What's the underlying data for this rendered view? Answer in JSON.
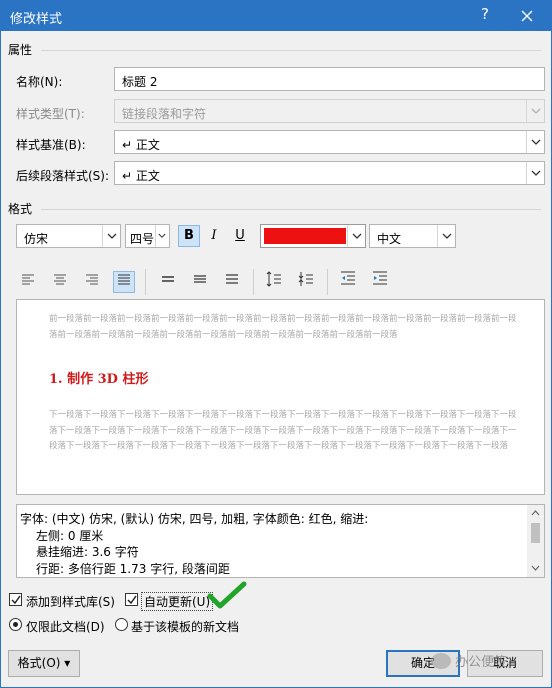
{
  "window": {
    "title": "修改样式",
    "help_glyph": "?"
  },
  "properties": {
    "section_label": "属性",
    "name_label": "名称(N):",
    "name_value": "标题 2",
    "style_type_label": "样式类型(T):",
    "style_type_value": "链接段落和字符",
    "based_on_label": "样式基准(B):",
    "based_on_value": "↵ 正文",
    "next_style_label": "后续段落样式(S):",
    "next_style_value": "↵ 正文"
  },
  "format": {
    "section_label": "格式",
    "font": "仿宋",
    "size": "四号",
    "bold": "B",
    "italic": "I",
    "underline": "U",
    "font_color": "#ee1111",
    "script": "中文"
  },
  "preview": {
    "prev_paragraph": "前一段落前一段落前一段落前一段落前一段落前一段落前一段落前一段落前一段落前一段落前一段落前一段落前一段落前一段落前一段落前一段落前一段落前一段落前一段落前一段落前一段落前一段落前一段落前一段落",
    "sample": "1. 制作 3D 柱形",
    "next_paragraph": "下一段落下一段落下一段落下一段落下一段落下一段落下一段落下一段落下一段落下一段落下一段落下一段落下一段落下一段落下一段落下一段落下一段落下一段落下一段落下一段落下一段落下一段落下一段落下一段落下一段落下一段落下一段落下一段落下一段落下一段落下一段落下一段落下一段落下一段落下一段落下一段落下一段落下一段落下一段落下一段落下一段落"
  },
  "description": {
    "line1": "字体: (中文) 仿宋, (默认) 仿宋, 四号, 加粗, 字体颜色: 红色, 缩进:",
    "line2": "左侧:  0 厘米",
    "line3": "悬挂缩进: 3.6 字符",
    "line4": "行距: 多倍行距 1.73 字行, 段落间距"
  },
  "options": {
    "add_to_gallery": "添加到样式库(S)",
    "auto_update": "自动更新(U)",
    "only_this_doc": "仅限此文档(D)",
    "new_docs_template": "基于该模板的新文档"
  },
  "buttons": {
    "format": "格式(O)",
    "ok": "确定",
    "cancel": "取消"
  },
  "watermark": "办公便签",
  "colors": {
    "titlebar": "#2b74c4",
    "check_mark": "#22a32a"
  }
}
